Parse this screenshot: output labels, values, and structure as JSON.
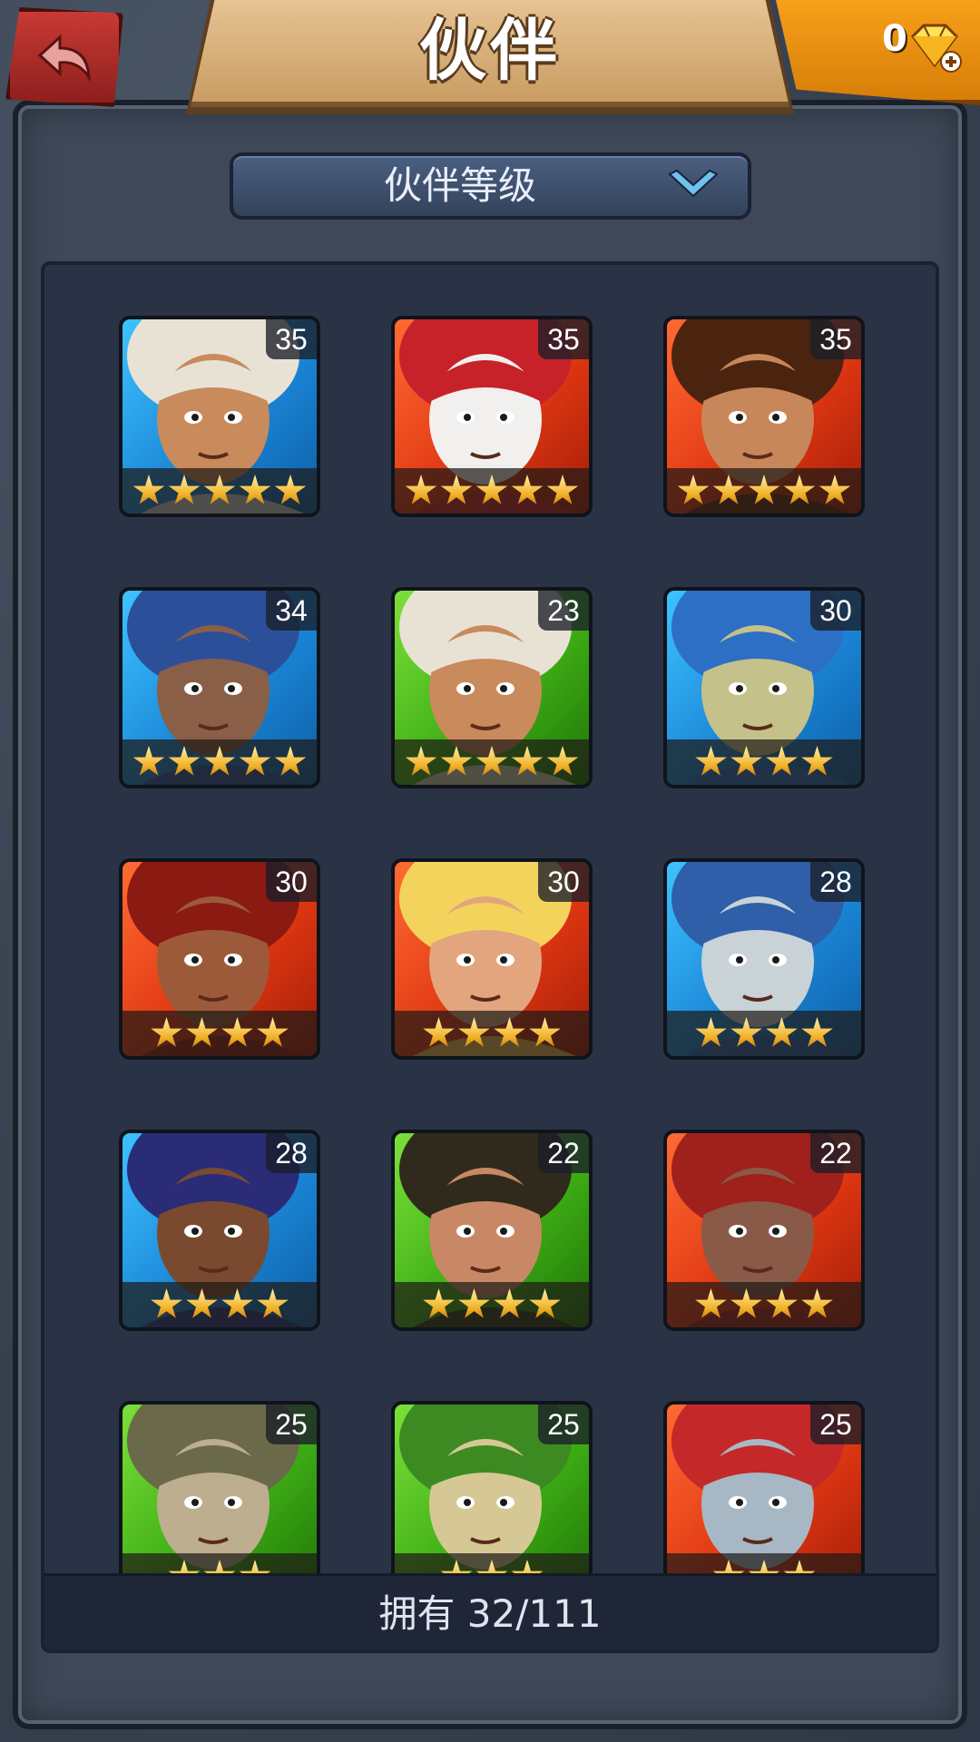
{
  "header": {
    "title": "伙伴",
    "gems": "0"
  },
  "sort": {
    "label": "伙伴等级"
  },
  "footer": {
    "owned_text": "拥有 32/111"
  },
  "colors": {
    "blue": "#1a86d6",
    "red": "#e03712",
    "green": "#3fae15",
    "star": "#f2b32a"
  },
  "companions": [
    {
      "level": "35",
      "stars": 5,
      "color": "blue",
      "portrait": "white-hair-hooded-woman"
    },
    {
      "level": "35",
      "stars": 5,
      "color": "red",
      "portrait": "fire-elephant-beast"
    },
    {
      "level": "35",
      "stars": 5,
      "color": "red",
      "portrait": "long-hair-warrior"
    },
    {
      "level": "34",
      "stars": 5,
      "color": "blue",
      "portrait": "hooded-mage-purple-glasses"
    },
    {
      "level": "23",
      "stars": 5,
      "color": "green",
      "portrait": "white-hair-hooded-woman"
    },
    {
      "level": "30",
      "stars": 4,
      "color": "blue",
      "portrait": "spotted-lizard-beast"
    },
    {
      "level": "30",
      "stars": 4,
      "color": "red",
      "portrait": "red-mane-barbarian"
    },
    {
      "level": "30",
      "stars": 4,
      "color": "red",
      "portrait": "blonde-woman-skull"
    },
    {
      "level": "28",
      "stars": 4,
      "color": "blue",
      "portrait": "armored-troll"
    },
    {
      "level": "28",
      "stars": 4,
      "color": "blue",
      "portrait": "afro-woman-headband"
    },
    {
      "level": "22",
      "stars": 4,
      "color": "green",
      "portrait": "dark-hair-woman"
    },
    {
      "level": "22",
      "stars": 4,
      "color": "red",
      "portrait": "hooded-mage-red"
    },
    {
      "level": "25",
      "stars": 3,
      "color": "green",
      "portrait": "bald-brute"
    },
    {
      "level": "25",
      "stars": 3,
      "color": "green",
      "portrait": "green-lizard-beast"
    },
    {
      "level": "25",
      "stars": 3,
      "color": "red",
      "portrait": "red-lizard-beast"
    }
  ]
}
